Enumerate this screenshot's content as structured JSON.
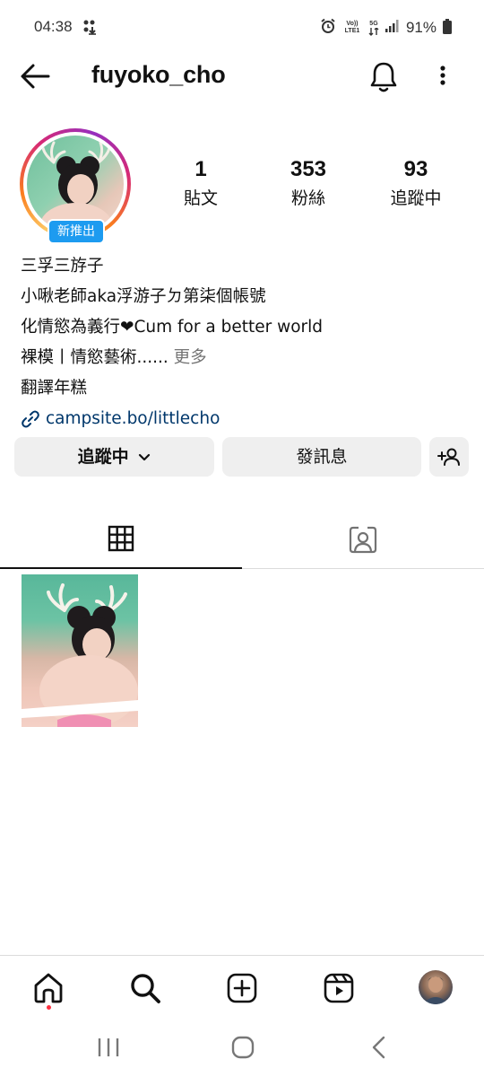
{
  "status_bar": {
    "time": "04:38",
    "battery": "91%",
    "volte_label": "Vo)) LTE1",
    "network_label": "5G"
  },
  "header": {
    "username": "fuyoko_cho",
    "icons": [
      "back-arrow-icon",
      "bell-icon",
      "more-vertical-icon"
    ]
  },
  "profile": {
    "badge": "新推出",
    "stats": [
      {
        "value": "1",
        "label": "貼文"
      },
      {
        "value": "353",
        "label": "粉絲"
      },
      {
        "value": "93",
        "label": "追蹤中"
      }
    ],
    "bio": {
      "name": "三孚三斿子",
      "line1": "小啾老師aka浮游子ㄉ第柒個帳號",
      "line2": "化情慾為義行❤Cum for a better world",
      "line3": "裸模丨情慾藝術......",
      "more": " 更多",
      "line4": "翻譯年糕",
      "link": "campsite.bo/littlecho"
    }
  },
  "actions": {
    "following": "追蹤中",
    "message": "發訊息"
  },
  "tabs": [
    {
      "name": "grid",
      "icon": "grid-icon",
      "active": true
    },
    {
      "name": "tagged",
      "icon": "tagged-person-icon",
      "active": false
    }
  ],
  "bottom_nav": {
    "items": [
      "home-icon",
      "search-icon",
      "create-icon",
      "reels-icon",
      "profile-avatar"
    ],
    "notification_color": "#ff3040"
  },
  "colors": {
    "link": "#00376b",
    "badge": "#1d9bf0",
    "button_bg": "#efefef",
    "muted": "#737373"
  }
}
